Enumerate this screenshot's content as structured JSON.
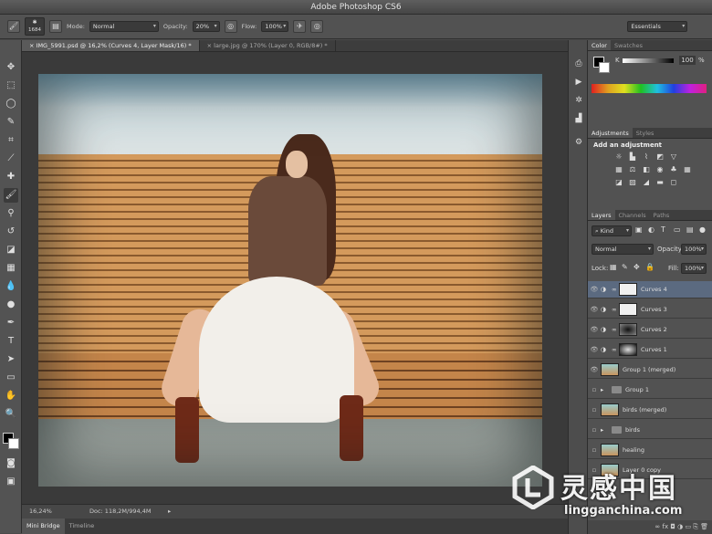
{
  "window": {
    "title": "Adobe Photoshop CS6"
  },
  "options_bar": {
    "brush_size": "1684",
    "mode_label": "Mode:",
    "mode_value": "Normal",
    "opacity_label": "Opacity:",
    "opacity_value": "20%",
    "flow_label": "Flow:",
    "flow_value": "100%",
    "workspace": "Essentials"
  },
  "doc_tabs": [
    {
      "label": "IMG_5991.psd @ 16,2% (Curves 4, Layer Mask/16) *",
      "active": true
    },
    {
      "label": "large.jpg @ 170% (Layer 0, RGB/8#) *",
      "active": false
    }
  ],
  "status": {
    "zoom": "16,24%",
    "doc_info": "Doc: 118,2M/994,4M"
  },
  "bottom_tabs": [
    "Mini Bridge",
    "Timeline"
  ],
  "color_panel": {
    "tabs": [
      "Color",
      "Swatches"
    ],
    "channel": "K",
    "value": "100",
    "unit": "%"
  },
  "adjustments_panel": {
    "tabs": [
      "Adjustments",
      "Styles"
    ],
    "heading": "Add an adjustment"
  },
  "layers_panel": {
    "tabs": [
      "Layers",
      "Channels",
      "Paths"
    ],
    "filter": "Kind",
    "blend_mode": "Normal",
    "opacity_label": "Opacity:",
    "opacity_value": "100%",
    "lock_label": "Lock:",
    "fill_label": "Fill:",
    "fill_value": "100%",
    "layers": [
      {
        "name": "Curves 4",
        "kind": "adjust",
        "selected": true
      },
      {
        "name": "Curves 3",
        "kind": "adjust"
      },
      {
        "name": "Curves 2",
        "kind": "adjust"
      },
      {
        "name": "Curves 1",
        "kind": "adjust"
      },
      {
        "name": "Group 1 (merged)",
        "kind": "pixel"
      },
      {
        "name": "Group 1",
        "kind": "group"
      },
      {
        "name": "birds (merged)",
        "kind": "pixel"
      },
      {
        "name": "birds",
        "kind": "group"
      },
      {
        "name": "healing",
        "kind": "pixel"
      },
      {
        "name": "Layer 0 copy",
        "kind": "pixel"
      }
    ]
  },
  "watermark": {
    "brand": "灵感中国",
    "url": "lingganchina.com"
  },
  "icons": {
    "brush": "brush-icon",
    "eye": "eye-icon",
    "link": "link-icon",
    "folder": "folder-icon",
    "lock": "lock-icon",
    "history": "history-icon",
    "gear": "gear-icon"
  },
  "colors": {
    "accent_selected": "#5b6a80",
    "panel_bg": "#525252",
    "foreground": "#000000",
    "background": "#ffffff"
  }
}
